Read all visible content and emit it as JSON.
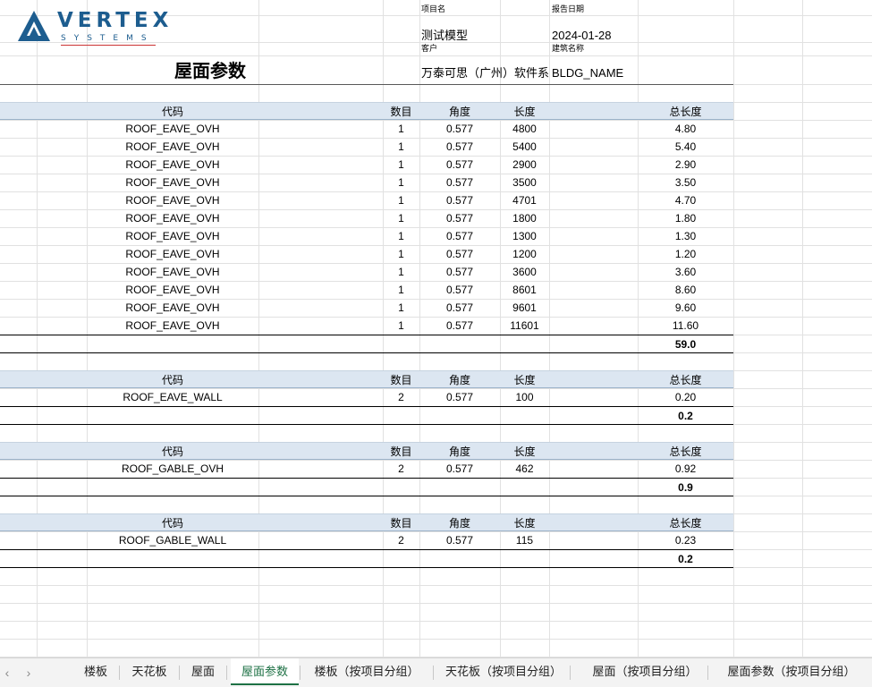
{
  "header": {
    "project_label": "项目名",
    "project_value": "测试模型",
    "date_label": "报告日期",
    "date_value": "2024-01-28",
    "client_label": "客户",
    "client_value": "万泰可思（广州）软件系",
    "building_label": "建筑名称",
    "building_value": "BLDG_NAME",
    "page_title": "屋面参数"
  },
  "logo": {
    "word": "VERTEX",
    "sub": "SYSTEMS"
  },
  "columns": {
    "code": "代码",
    "count": "数目",
    "angle": "角度",
    "length": "长度",
    "total": "总长度"
  },
  "groups": [
    {
      "rows": [
        {
          "code": "ROOF_EAVE_OVH",
          "count": "1",
          "angle": "0.577",
          "length": "4800",
          "total": "4.80"
        },
        {
          "code": "ROOF_EAVE_OVH",
          "count": "1",
          "angle": "0.577",
          "length": "5400",
          "total": "5.40"
        },
        {
          "code": "ROOF_EAVE_OVH",
          "count": "1",
          "angle": "0.577",
          "length": "2900",
          "total": "2.90"
        },
        {
          "code": "ROOF_EAVE_OVH",
          "count": "1",
          "angle": "0.577",
          "length": "3500",
          "total": "3.50"
        },
        {
          "code": "ROOF_EAVE_OVH",
          "count": "1",
          "angle": "0.577",
          "length": "4701",
          "total": "4.70"
        },
        {
          "code": "ROOF_EAVE_OVH",
          "count": "1",
          "angle": "0.577",
          "length": "1800",
          "total": "1.80"
        },
        {
          "code": "ROOF_EAVE_OVH",
          "count": "1",
          "angle": "0.577",
          "length": "1300",
          "total": "1.30"
        },
        {
          "code": "ROOF_EAVE_OVH",
          "count": "1",
          "angle": "0.577",
          "length": "1200",
          "total": "1.20"
        },
        {
          "code": "ROOF_EAVE_OVH",
          "count": "1",
          "angle": "0.577",
          "length": "3600",
          "total": "3.60"
        },
        {
          "code": "ROOF_EAVE_OVH",
          "count": "1",
          "angle": "0.577",
          "length": "8601",
          "total": "8.60"
        },
        {
          "code": "ROOF_EAVE_OVH",
          "count": "1",
          "angle": "0.577",
          "length": "9601",
          "total": "9.60"
        },
        {
          "code": "ROOF_EAVE_OVH",
          "count": "1",
          "angle": "0.577",
          "length": "11601",
          "total": "11.60"
        }
      ],
      "sum": "59.0"
    },
    {
      "rows": [
        {
          "code": "ROOF_EAVE_WALL",
          "count": "2",
          "angle": "0.577",
          "length": "100",
          "total": "0.20"
        }
      ],
      "sum": "0.2"
    },
    {
      "rows": [
        {
          "code": "ROOF_GABLE_OVH",
          "count": "2",
          "angle": "0.577",
          "length": "462",
          "total": "0.92"
        }
      ],
      "sum": "0.9"
    },
    {
      "rows": [
        {
          "code": "ROOF_GABLE_WALL",
          "count": "2",
          "angle": "0.577",
          "length": "115",
          "total": "0.23"
        }
      ],
      "sum": "0.2"
    }
  ],
  "tabs": [
    {
      "label": "楼板",
      "active": false
    },
    {
      "label": "天花板",
      "active": false
    },
    {
      "label": "屋面",
      "active": false
    },
    {
      "label": "屋面参数",
      "active": true
    },
    {
      "label": "楼板（按项目分组）",
      "active": false
    },
    {
      "label": "天花板（按项目分组）",
      "active": false
    },
    {
      "label": "屋面（按项目分组）",
      "active": false
    },
    {
      "label": "屋面参数（按项目分组）",
      "active": false
    }
  ],
  "nav": {
    "prev_icon": "‹",
    "next_icon": "›"
  },
  "colors": {
    "header_band": "#dce6f1",
    "active_tab": "#1e7145",
    "logo": "#1d5d8f",
    "logo_accent": "#c33"
  }
}
